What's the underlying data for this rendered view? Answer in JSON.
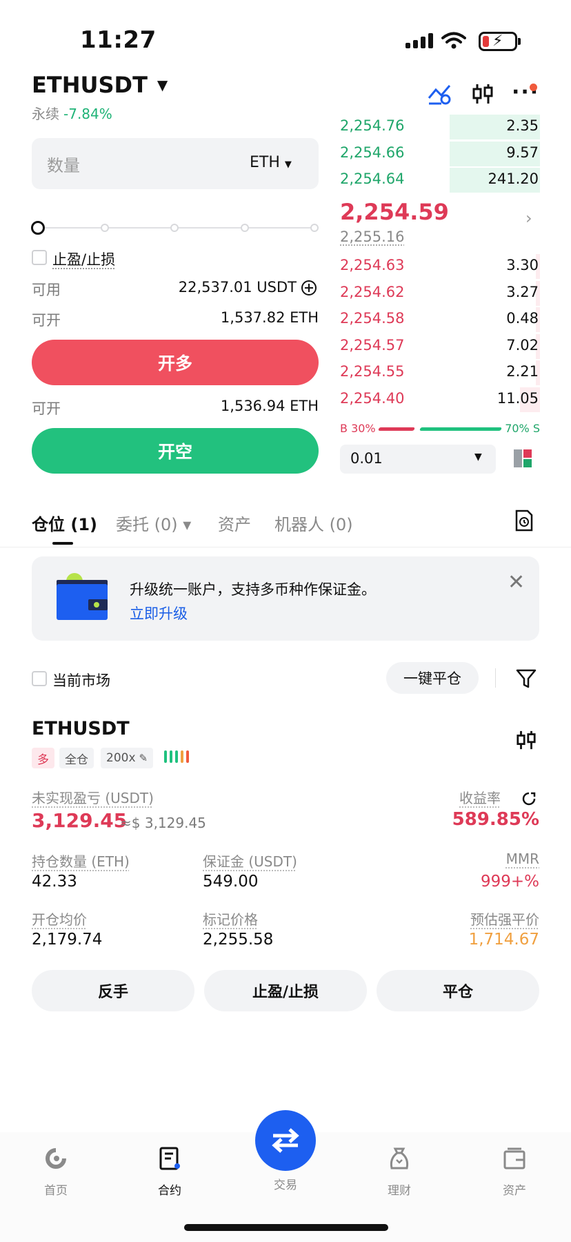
{
  "status_bar": {
    "time": "11:27"
  },
  "header": {
    "symbol": "ETHUSDT",
    "contract_type": "永续",
    "change_pct": "-7.84%"
  },
  "order_form": {
    "quantity_placeholder": "数量",
    "quantity_unit": "ETH",
    "tpsl_label": "止盈/止损",
    "available_label": "可用",
    "available_value": "22,537.01 USDT",
    "open_long_label": "可开",
    "open_long_value": "1,537.82 ETH",
    "long_button": "开多",
    "open_short_label": "可开",
    "open_short_value": "1,536.94 ETH",
    "short_button": "开空"
  },
  "order_book": {
    "asks": [
      {
        "price": "2,254.76",
        "amount": "2.35",
        "depth": 0.45
      },
      {
        "price": "2,254.66",
        "amount": "9.57",
        "depth": 0.45
      },
      {
        "price": "2,254.64",
        "amount": "241.20",
        "depth": 0.45
      }
    ],
    "last_price": "2,254.59",
    "mark_price": "2,255.16",
    "bids": [
      {
        "price": "2,254.63",
        "amount": "3.30",
        "depth": 0.02
      },
      {
        "price": "2,254.62",
        "amount": "3.27",
        "depth": 0.02
      },
      {
        "price": "2,254.58",
        "amount": "0.48",
        "depth": 0.02
      },
      {
        "price": "2,254.57",
        "amount": "7.02",
        "depth": 0.02
      },
      {
        "price": "2,254.55",
        "amount": "2.21",
        "depth": 0.02
      },
      {
        "price": "2,254.40",
        "amount": "11.05",
        "depth": 0.1
      }
    ],
    "buy_ratio": "B 30%",
    "sell_ratio": "70% S",
    "precision": "0.01",
    "colors": {
      "ask": "#1fa66a",
      "bid": "#de3a57",
      "ask_bg": "#e4f7ee",
      "bid_bg": "#fdecef"
    }
  },
  "tabs": [
    {
      "label": "仓位 (1)",
      "active": true
    },
    {
      "label": "委托 (0) ▾",
      "active": false
    },
    {
      "label": "资产",
      "active": false
    },
    {
      "label": "机器人 (0)",
      "active": false
    }
  ],
  "banner": {
    "text": "升级统一账户，支持多币种作保证金。",
    "link": "立即升级"
  },
  "filters": {
    "current_market_label": "当前市场",
    "close_all_button": "一键平仓"
  },
  "position": {
    "symbol": "ETHUSDT",
    "side_tag": "多",
    "margin_mode_tag": "全仓",
    "leverage_tag": "200x",
    "unrealized_pnl_label": "未实现盈亏 (USDT)",
    "unrealized_pnl": "3,129.45",
    "unrealized_pnl_approx": "≈$ 3,129.45",
    "roe_label": "收益率",
    "roe": "589.85%",
    "size_label": "持仓数量 (ETH)",
    "size": "42.33",
    "margin_label": "保证金 (USDT)",
    "margin": "549.00",
    "mmr_label": "MMR",
    "mmr": "999+%",
    "entry_label": "开仓均价",
    "entry": "2,179.74",
    "mark_label": "标记价格",
    "mark": "2,255.58",
    "liq_label": "预估强平价",
    "liq": "1,714.67",
    "actions": {
      "reverse": "反手",
      "tpsl": "止盈/止损",
      "close": "平仓"
    }
  },
  "bottom_nav": [
    {
      "label": "首页",
      "icon": "home-icon"
    },
    {
      "label": "合约",
      "icon": "contract-icon",
      "active": true
    },
    {
      "label": "交易",
      "icon": "swap-icon"
    },
    {
      "label": "理财",
      "icon": "wealth-icon"
    },
    {
      "label": "资产",
      "icon": "wallet-icon"
    }
  ]
}
